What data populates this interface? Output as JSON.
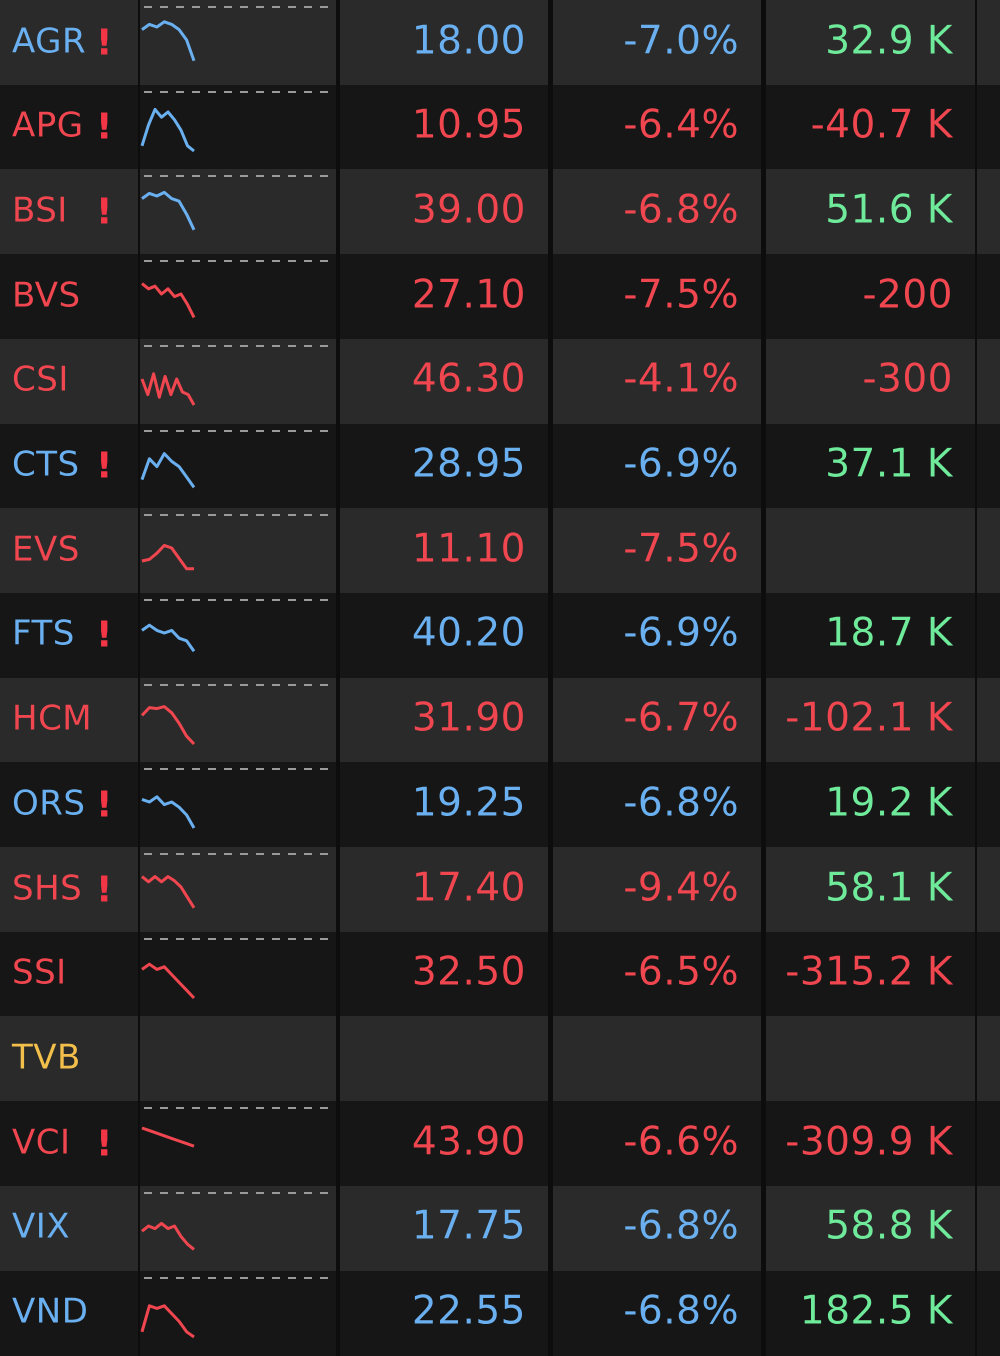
{
  "colors": {
    "row_bg_odd": "#2a2a2a",
    "row_bg_even": "#161616",
    "divider": "#0d0d0d",
    "blue": "#6ab0f0",
    "red": "#f0464f",
    "green": "#6eea9a",
    "yellow": "#f3bf4b",
    "warning": "#f23645",
    "dashed_line": "#9a9a9a"
  },
  "stocks": [
    {
      "symbol": "AGR",
      "symbol_color": "blue",
      "warning_icon": "!",
      "sparkline_color": "blue",
      "sparkline_shape": [
        0.3,
        0.2,
        0.25,
        0.15,
        0.2,
        0.3,
        0.5,
        0.9
      ],
      "price": "18.00",
      "price_color": "blue",
      "change_pct": "-7.0%",
      "change_color": "blue",
      "volume": "32.9 K",
      "volume_color": "green"
    },
    {
      "symbol": "APG",
      "symbol_color": "red",
      "warning_icon": "!",
      "sparkline_color": "blue",
      "sparkline_shape": [
        0.9,
        0.5,
        0.2,
        0.35,
        0.25,
        0.4,
        0.6,
        0.9,
        1.0
      ],
      "price": "10.95",
      "price_color": "red",
      "change_pct": "-6.4%",
      "change_color": "red",
      "volume": "-40.7 K",
      "volume_color": "red"
    },
    {
      "symbol": "BSI",
      "symbol_color": "red",
      "warning_icon": "!",
      "sparkline_color": "blue",
      "sparkline_shape": [
        0.3,
        0.2,
        0.25,
        0.18,
        0.3,
        0.35,
        0.6,
        0.9
      ],
      "price": "39.00",
      "price_color": "red",
      "change_pct": "-6.8%",
      "change_color": "red",
      "volume": "51.6 K",
      "volume_color": "green"
    },
    {
      "symbol": "BVS",
      "symbol_color": "red",
      "warning_icon": "",
      "sparkline_color": "red",
      "sparkline_shape": [
        0.3,
        0.4,
        0.35,
        0.5,
        0.4,
        0.55,
        0.5,
        0.7,
        0.95
      ],
      "price": "27.10",
      "price_color": "red",
      "change_pct": "-7.5%",
      "change_color": "red",
      "volume": "-200",
      "volume_color": "red"
    },
    {
      "symbol": "CSI",
      "symbol_color": "red",
      "warning_icon": "",
      "sparkline_color": "red",
      "sparkline_shape": [
        0.5,
        0.8,
        0.4,
        0.85,
        0.45,
        0.8,
        0.5,
        0.75,
        0.8,
        1.0
      ],
      "price": "46.30",
      "price_color": "red",
      "change_pct": "-4.1%",
      "change_color": "red",
      "volume": "-300",
      "volume_color": "red"
    },
    {
      "symbol": "CTS",
      "symbol_color": "blue",
      "warning_icon": "!",
      "sparkline_color": "blue",
      "sparkline_shape": [
        0.8,
        0.4,
        0.55,
        0.3,
        0.45,
        0.55,
        0.75,
        0.95
      ],
      "price": "28.95",
      "price_color": "blue",
      "change_pct": "-6.9%",
      "change_color": "blue",
      "volume": "37.1 K",
      "volume_color": "green"
    },
    {
      "symbol": "EVS",
      "symbol_color": "red",
      "warning_icon": "",
      "sparkline_color": "red",
      "sparkline_shape": [
        0.75,
        0.72,
        0.6,
        0.45,
        0.5,
        0.7,
        0.9,
        0.9
      ],
      "price": "11.10",
      "price_color": "red",
      "change_pct": "-7.5%",
      "change_color": "red",
      "volume": "",
      "volume_color": "green"
    },
    {
      "symbol": "FTS",
      "symbol_color": "blue",
      "warning_icon": "!",
      "sparkline_color": "blue",
      "sparkline_shape": [
        0.45,
        0.35,
        0.45,
        0.5,
        0.45,
        0.6,
        0.65,
        0.85
      ],
      "price": "40.20",
      "price_color": "blue",
      "change_pct": "-6.9%",
      "change_color": "blue",
      "volume": "18.7 K",
      "volume_color": "green"
    },
    {
      "symbol": "HCM",
      "symbol_color": "red",
      "warning_icon": "",
      "sparkline_color": "red",
      "sparkline_shape": [
        0.45,
        0.3,
        0.32,
        0.28,
        0.4,
        0.6,
        0.85,
        1.0
      ],
      "price": "31.90",
      "price_color": "red",
      "change_pct": "-6.7%",
      "change_color": "red",
      "volume": "-102.1 K",
      "volume_color": "red"
    },
    {
      "symbol": "ORS",
      "symbol_color": "blue",
      "warning_icon": "!",
      "sparkline_color": "blue",
      "sparkline_shape": [
        0.45,
        0.5,
        0.4,
        0.55,
        0.5,
        0.6,
        0.75,
        1.0
      ],
      "price": "19.25",
      "price_color": "blue",
      "change_pct": "-6.8%",
      "change_color": "blue",
      "volume": "19.2 K",
      "volume_color": "green"
    },
    {
      "symbol": "SHS",
      "symbol_color": "red",
      "warning_icon": "!",
      "sparkline_color": "red",
      "sparkline_shape": [
        0.3,
        0.4,
        0.3,
        0.4,
        0.3,
        0.38,
        0.5,
        0.7,
        0.9
      ],
      "price": "17.40",
      "price_color": "red",
      "change_pct": "-9.4%",
      "change_color": "red",
      "volume": "58.1 K",
      "volume_color": "green"
    },
    {
      "symbol": "SSI",
      "symbol_color": "red",
      "warning_icon": "",
      "sparkline_color": "red",
      "sparkline_shape": [
        0.45,
        0.35,
        0.45,
        0.4,
        0.55,
        0.7,
        0.85,
        1.0
      ],
      "price": "32.50",
      "price_color": "red",
      "change_pct": "-6.5%",
      "change_color": "red",
      "volume": "-315.2 K",
      "volume_color": "red"
    },
    {
      "symbol": "TVB",
      "symbol_color": "yellow",
      "warning_icon": "",
      "sparkline_color": "",
      "sparkline_shape": [],
      "price": "",
      "price_color": "blue",
      "change_pct": "",
      "change_color": "blue",
      "volume": "",
      "volume_color": "green"
    },
    {
      "symbol": "VCI",
      "symbol_color": "red",
      "warning_icon": "!",
      "sparkline_color": "red",
      "sparkline_shape": [
        0.25,
        0.3,
        0.35,
        0.4,
        0.45,
        0.5,
        0.55,
        0.6
      ],
      "price": "43.90",
      "price_color": "red",
      "change_pct": "-6.6%",
      "change_color": "red",
      "volume": "-309.9 K",
      "volume_color": "red"
    },
    {
      "symbol": "VIX",
      "symbol_color": "blue",
      "warning_icon": "",
      "sparkline_color": "red",
      "sparkline_shape": [
        0.6,
        0.5,
        0.55,
        0.45,
        0.55,
        0.5,
        0.7,
        0.85,
        0.95
      ],
      "price": "17.75",
      "price_color": "blue",
      "change_pct": "-6.8%",
      "change_color": "blue",
      "volume": "58.8 K",
      "volume_color": "green"
    },
    {
      "symbol": "VND",
      "symbol_color": "blue",
      "warning_icon": "",
      "sparkline_color": "red",
      "sparkline_shape": [
        0.9,
        0.4,
        0.45,
        0.4,
        0.55,
        0.7,
        0.9,
        1.0
      ],
      "price": "22.55",
      "price_color": "blue",
      "change_pct": "-6.8%",
      "change_color": "blue",
      "volume": "182.5 K",
      "volume_color": "green"
    }
  ]
}
